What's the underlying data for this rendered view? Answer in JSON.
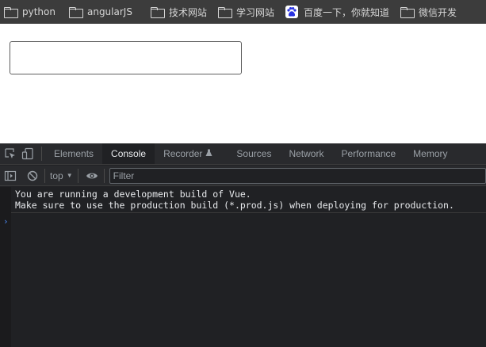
{
  "bookmarks": [
    {
      "label": "python",
      "icon": "folder-icon"
    },
    {
      "label": "angularJS",
      "icon": "folder-icon"
    },
    {
      "label": "技术网站",
      "icon": "folder-icon"
    },
    {
      "label": "学习网站",
      "icon": "folder-icon"
    },
    {
      "label": "百度一下，你就知道",
      "icon": "baidu-paw-icon"
    },
    {
      "label": "微信开发",
      "icon": "folder-icon"
    }
  ],
  "devtools": {
    "tabs": [
      {
        "label": "Elements",
        "active": false
      },
      {
        "label": "Console",
        "active": true
      },
      {
        "label": "Recorder",
        "active": false
      },
      {
        "label": "Sources",
        "active": false
      },
      {
        "label": "Network",
        "active": false
      },
      {
        "label": "Performance",
        "active": false
      },
      {
        "label": "Memory",
        "active": false
      }
    ],
    "toolbar": {
      "context": "top",
      "filter_placeholder": "Filter"
    },
    "console_lines": [
      "You are running a development build of Vue.",
      "Make sure to use the production build (*.prod.js) when deploying for production."
    ],
    "prompt": "›"
  },
  "colors": {
    "bookmarks_bg": "#3c3c3c",
    "devtools_bg": "#202124",
    "prompt": "#4c8bf5"
  }
}
